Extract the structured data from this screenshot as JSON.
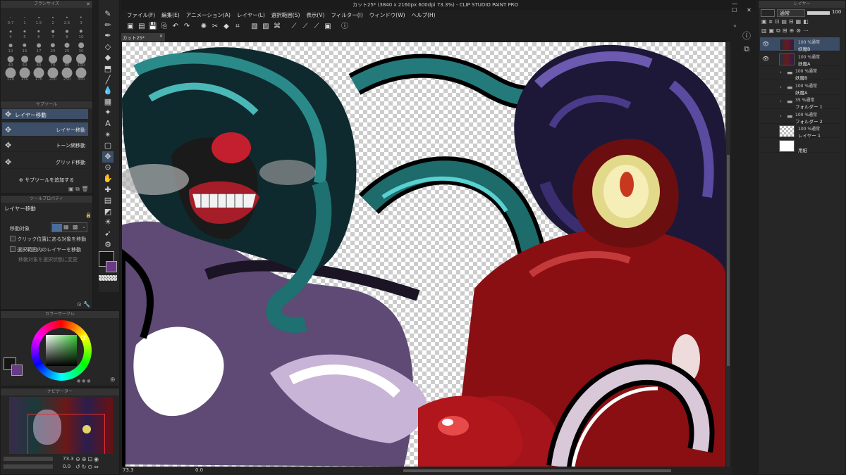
{
  "app": {
    "title": "カット25* (3840 x 2160px 600dpi 73.3%) - CLIP STUDIO PAINT PRO",
    "doc_tab": "カット25*"
  },
  "menu": [
    "ファイル(F)",
    "編集(E)",
    "アニメーション(A)",
    "レイヤー(L)",
    "選択範囲(S)",
    "表示(V)",
    "フィルター(I)",
    "ウィンドウ(W)",
    "ヘルプ(H)"
  ],
  "brush_panel": {
    "title": "ブラシサイズ",
    "sizes": [
      "0.7",
      "1",
      "1.5",
      "2",
      "2.5",
      "3",
      "4",
      "5",
      "6",
      "7",
      "8",
      "10",
      "12",
      "15",
      "17",
      "20",
      "25",
      "30",
      "40",
      "50",
      "60",
      "70",
      "80",
      "100",
      "120",
      "150",
      "170",
      "200",
      "250",
      "300"
    ]
  },
  "subtool_panel": {
    "title": "サブツール",
    "group": "レイヤー移動",
    "items": [
      "レイヤー移動",
      "トーン網移動",
      "グリッド移動"
    ],
    "add_label": "サブツールを追加する"
  },
  "tool_property": {
    "title": "ツールプロパティ",
    "header": "レイヤー移動",
    "move_target_label": "移動対象",
    "options": [
      "クリック位置にある対象を移動",
      "選択範囲内のレイヤーを移動"
    ],
    "disabled_option": "移動対象を選択状態に変更"
  },
  "color_panel": {
    "title": "カラーサークル",
    "accent": "#47a84a",
    "fg": "#141414",
    "bg": "#6a3a86"
  },
  "navigator": {
    "title": "ナビゲーター",
    "zoom": "73.3",
    "angle": "0.0"
  },
  "status": {
    "zoom": "73.3",
    "angle": "0.0"
  },
  "layers_panel": {
    "title": "レイヤー",
    "blend_mode": "通常",
    "opacity": "100",
    "layers": [
      {
        "l1": "100 %通常",
        "l2": "妖魔B",
        "kind": "image",
        "selected": true,
        "visible": true
      },
      {
        "l1": "100 %通常",
        "l2": "妖魔A",
        "kind": "image",
        "selected": false,
        "visible": true
      },
      {
        "l1": "100 %通常",
        "l2": "妖魔B",
        "kind": "folder",
        "selected": false,
        "visible": false
      },
      {
        "l1": "100 %通常",
        "l2": "妖魔A",
        "kind": "folder",
        "selected": false,
        "visible": false
      },
      {
        "l1": "35 %通常",
        "l2": "フォルダー 1",
        "kind": "folder",
        "selected": false,
        "visible": false
      },
      {
        "l1": "100 %通常",
        "l2": "フォルダー 2",
        "kind": "folder",
        "selected": false,
        "visible": false
      },
      {
        "l1": "100 %通常",
        "l2": "レイヤー 1",
        "kind": "blank",
        "selected": false,
        "visible": false
      },
      {
        "l1": "",
        "l2": "用紙",
        "kind": "paper",
        "selected": false,
        "visible": false
      }
    ]
  },
  "colors": {
    "panel": "#262626",
    "selected": "#3b4c66",
    "canvas_bg": "#1e1e1e"
  }
}
